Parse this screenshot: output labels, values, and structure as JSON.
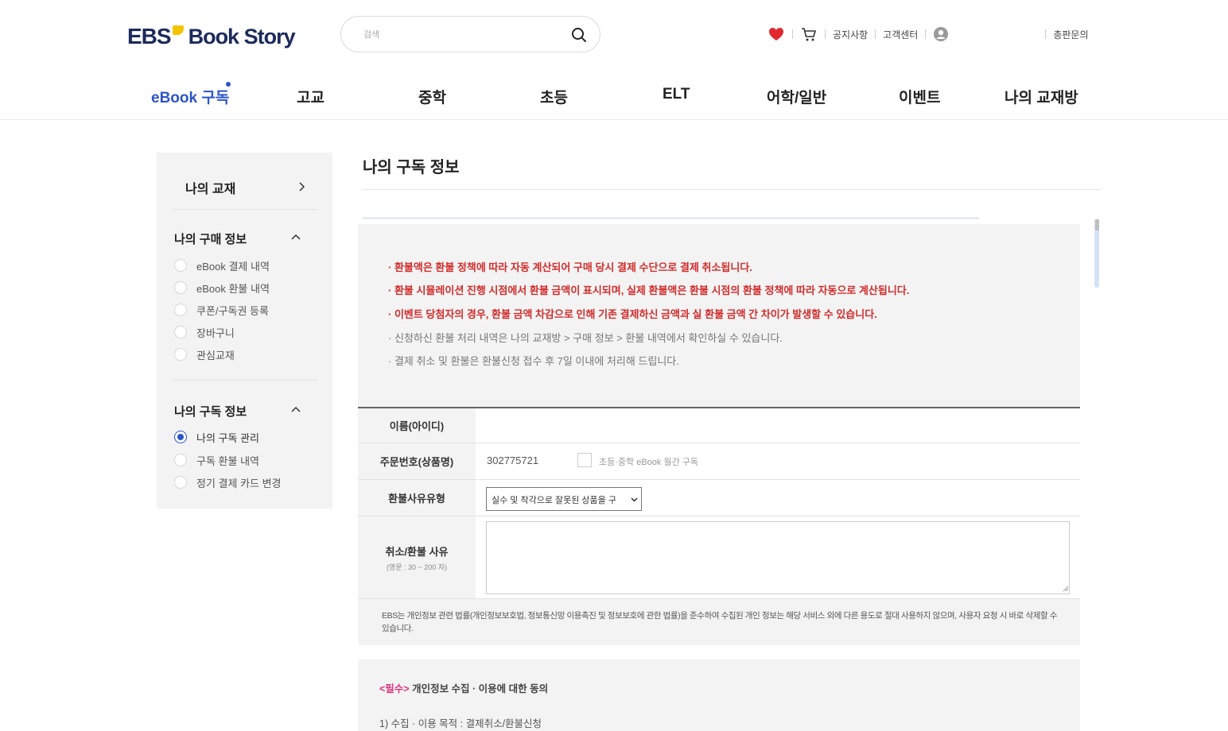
{
  "brand": {
    "ebs": "EBS",
    "bookstory": "Book Story"
  },
  "search": {
    "placeholder": "검색"
  },
  "util": {
    "notice": "공지사항",
    "support": "고객센터",
    "sales": "총판문의"
  },
  "gnb": [
    "eBook 구독",
    "고교",
    "중학",
    "초등",
    "ELT",
    "어학/일반",
    "이벤트",
    "나의 교재방"
  ],
  "sidebar": {
    "top_link": "나의 교재",
    "purchase": {
      "title": "나의 구매 정보",
      "items": [
        "eBook 결제 내역",
        "eBook 환불 내역",
        "쿠폰/구독권 등록",
        "장바구니",
        "관심교재"
      ]
    },
    "subscription": {
      "title": "나의 구독 정보",
      "items": [
        "나의 구독 관리",
        "구독 환불 내역",
        "정기 결제 카드 변경"
      ],
      "selected": "나의 구독 관리"
    }
  },
  "main": {
    "title": "나의 구독 정보",
    "notices": [
      "· 환불액은 환불 정책에 따라 자동 계산되어 구매 당시 결제 수단으로 결제 취소됩니다.",
      "· 환불 시뮬레이션 진행 시점에서 환불 금액이 표시되며, 실제 환불액은 환불 시점의 환불 정책에 따라 자동으로 계산됩니다.",
      "· 이벤트 당첨자의 경우, 환불 금액 차감으로 인해 기존 결제하신 금액과 실 환불 금액 간 차이가 발생할 수 있습니다.",
      "· 신청하신 환불 처리 내역은 나의 교재방 > 구매 정보 > 환불 내역에서 확인하실 수 있습니다.",
      "· 결제 취소 및 환불은 환불신청 접수 후 7일 이내에 처리해 드립니다."
    ],
    "form": {
      "name_label": "이름(아이디)",
      "order_label": "주문번호(상품명)",
      "order_no": "302775721",
      "product": "초등·중학 eBook 월간 구독",
      "reason_type_label": "환불사유유형",
      "reason_type_value": "실수 및 착각으로 잘못된 상품을 구",
      "reason_label": "취소/환불 사유",
      "reason_hint": "(영문 : 30 ~ 200 자)"
    },
    "privacy_note": "EBS는 개인정보 관련 법률(개인정보보호법, 정보통신망 이용촉진 및 정보보호에 관한 법률)을 준수하여 수집된 개인 정보는 해당 서비스 외에 다른 용도로 절대 사용하지 않으며, 사용자 요청 시 바로 삭제할 수 있습니다.",
    "consent": {
      "required": "<필수>",
      "title": " 개인정보 수집 · 이용에 대한 동의",
      "item1": "1) 수집 · 이용 목적 : 결제취소/환불신청"
    }
  },
  "colors": {
    "accent": "#2b55c7",
    "warning": "#d22c2c",
    "heart": "#e0282e",
    "brand_navy": "#1c2a5c",
    "brand_yellow": "#f5c400"
  }
}
